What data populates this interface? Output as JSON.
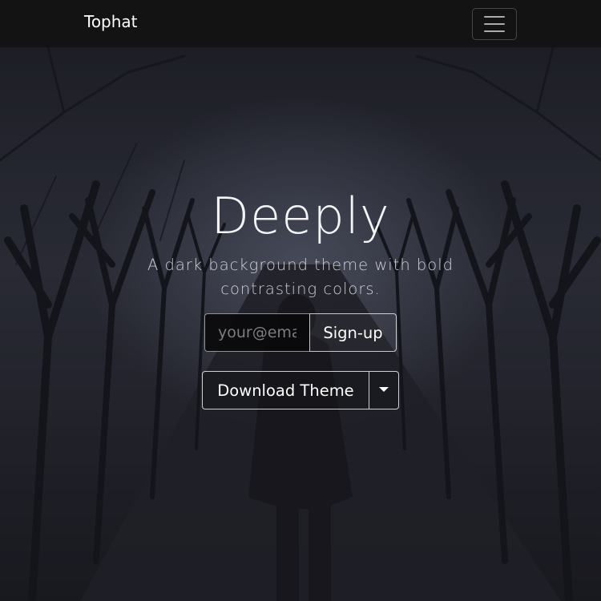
{
  "navbar": {
    "brand": "Tophat",
    "toggler_icon": "hamburger-icon"
  },
  "hero": {
    "title": "Deeply",
    "lead": "A dark background theme with bold contrasting colors."
  },
  "signup": {
    "email_placeholder": "your@email.com",
    "email_value": "",
    "button_label": "Sign-up"
  },
  "download": {
    "button_label": "Download Theme",
    "dropdown_icon": "caret-down-icon"
  },
  "colors": {
    "navbar_bg": "#121214",
    "background": "#2b2d37",
    "text": "#ffffff"
  }
}
